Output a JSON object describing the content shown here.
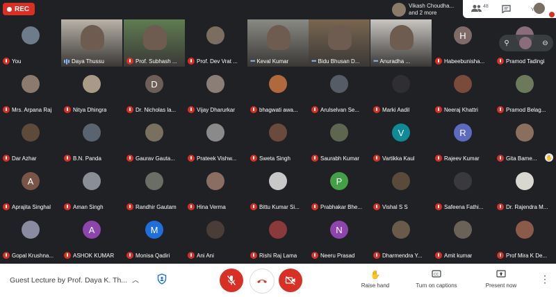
{
  "recording": {
    "label": "REC"
  },
  "presenter": {
    "name_line": "Vikash Choudha...",
    "more_line": "and 2 more"
  },
  "top_controls": {
    "participant_count": "48",
    "you_label": "You"
  },
  "participants": [
    {
      "name": "You",
      "kind": "avatar",
      "color": "#6d7b8a",
      "muted": true
    },
    {
      "name": "Daya Thussu",
      "kind": "video",
      "color": "#b9b3a8",
      "speaking": true
    },
    {
      "name": "Prof. Subhash ...",
      "kind": "video",
      "color": "#5f7d52"
    },
    {
      "name": "Prof. Dev Vrat ...",
      "kind": "avatar",
      "color": "#7b6e61",
      "muted": true
    },
    {
      "name": "Keval Kumar",
      "kind": "video",
      "color": "#8a8a84",
      "dots": true
    },
    {
      "name": "Bidu Bhusan D...",
      "kind": "video",
      "color": "#7a6650",
      "dots": true
    },
    {
      "name": "Anuradha ...",
      "kind": "video",
      "color": "#c9c6c2",
      "dots": true
    },
    {
      "name": "Habeebunisha...",
      "kind": "letter",
      "letter": "H",
      "color": "#7e6a66",
      "muted": true
    },
    {
      "name": "Pramod Tadingi",
      "kind": "avatar",
      "color": "#8a6d78",
      "muted": true
    },
    {
      "name": "Mrs. Arpana Raj",
      "kind": "avatar",
      "color": "#8c7a6e",
      "muted": true
    },
    {
      "name": "Nitya Dhingra",
      "kind": "avatar",
      "color": "#a89a84",
      "muted": true
    },
    {
      "name": "Dr. Nicholas la...",
      "kind": "letter",
      "letter": "D",
      "color": "#6d5e57",
      "muted": true
    },
    {
      "name": "Vijay Dharurkar",
      "kind": "avatar",
      "color": "#8b7e76",
      "muted": true
    },
    {
      "name": "bhagwati awa...",
      "kind": "avatar",
      "color": "#b0683f",
      "muted": true
    },
    {
      "name": "Arulselvan Se...",
      "kind": "avatar",
      "color": "#555c66",
      "muted": true
    },
    {
      "name": "Marki Aadil",
      "kind": "avatar",
      "color": "#2f2f33",
      "muted": true
    },
    {
      "name": "Neeraj Khattri",
      "kind": "avatar",
      "color": "#7a4a3a",
      "muted": true
    },
    {
      "name": "Pramod Belag...",
      "kind": "avatar",
      "color": "#6a7a5a",
      "muted": true
    },
    {
      "name": "Dar Azhar",
      "kind": "avatar",
      "color": "#5d4a3a",
      "muted": true
    },
    {
      "name": "B.N. Panda",
      "kind": "avatar",
      "color": "#5a6470",
      "muted": true
    },
    {
      "name": "Gaurav Gauta...",
      "kind": "avatar",
      "color": "#7a7060",
      "muted": true
    },
    {
      "name": "Prateek Vishw...",
      "kind": "avatar",
      "color": "#8a8a8a",
      "muted": true
    },
    {
      "name": "Sweta Singh",
      "kind": "avatar",
      "color": "#6a4a3c",
      "muted": true
    },
    {
      "name": "Saurabh Kumar",
      "kind": "avatar",
      "color": "#5e6650",
      "muted": true
    },
    {
      "name": "Vartikka Kaul",
      "kind": "letter",
      "letter": "V",
      "color": "#0f8a96",
      "muted": true
    },
    {
      "name": "Rajeev Kumar",
      "kind": "letter",
      "letter": "R",
      "color": "#5c6bc0",
      "muted": true
    },
    {
      "name": "Gita Bame...",
      "kind": "avatar",
      "color": "#8a6e5e",
      "muted": true,
      "hand": true
    },
    {
      "name": "Aprajita Singhal",
      "kind": "letter",
      "letter": "A",
      "color": "#795548",
      "muted": true
    },
    {
      "name": "Aman Singh",
      "kind": "avatar",
      "color": "#8a8e96",
      "muted": true
    },
    {
      "name": "Randhir Gautam",
      "kind": "avatar",
      "color": "#6a6e64",
      "muted": true
    },
    {
      "name": "Hina Verma",
      "kind": "avatar",
      "color": "#8a6e62",
      "muted": true
    },
    {
      "name": "Bittu Kumar Si...",
      "kind": "avatar",
      "color": "#c8c8c8",
      "muted": true
    },
    {
      "name": "Prabhakar Bhe...",
      "kind": "letter",
      "letter": "P",
      "color": "#43a047",
      "muted": true
    },
    {
      "name": "Vishal S S",
      "kind": "avatar",
      "color": "#5a4a3c",
      "muted": true
    },
    {
      "name": "Safeena Fathi...",
      "kind": "avatar",
      "color": "#3a3a3e",
      "muted": true
    },
    {
      "name": "Dr. Rajendra M...",
      "kind": "avatar",
      "color": "#d8d8d0",
      "muted": true
    },
    {
      "name": "Gopal Krushna...",
      "kind": "avatar",
      "color": "#8a8aa0",
      "muted": true
    },
    {
      "name": "ASHOK KUMAR",
      "kind": "letter",
      "letter": "A",
      "color": "#8e44ad",
      "muted": true
    },
    {
      "name": "Monisa Qadiri",
      "kind": "letter",
      "letter": "M",
      "color": "#1e6fd9",
      "muted": true
    },
    {
      "name": "Ani Ani",
      "kind": "avatar",
      "color": "#4a3c36",
      "muted": true
    },
    {
      "name": "Rishi Raj Lama",
      "kind": "avatar",
      "color": "#8a3a3a",
      "muted": true
    },
    {
      "name": "Neeru Prasad",
      "kind": "letter",
      "letter": "N",
      "color": "#8e44ad",
      "muted": true
    },
    {
      "name": "Dharmendra Y...",
      "kind": "avatar",
      "color": "#6a5a4a",
      "muted": true
    },
    {
      "name": "Amit kumar",
      "kind": "avatar",
      "color": "#6a6256",
      "muted": true
    },
    {
      "name": "Prof Mira K De...",
      "kind": "avatar",
      "color": "#8a5a4a",
      "muted": true
    }
  ],
  "bottom": {
    "meeting_title": "Guest Lecture by Prof. Daya K. Th...",
    "raise_hand": "Raise hand",
    "captions": "Turn on captions",
    "present": "Present now"
  },
  "colors": {
    "accent": "#8ab4f8",
    "danger": "#d93025",
    "tile": "#3c4043",
    "background": "#202124"
  }
}
